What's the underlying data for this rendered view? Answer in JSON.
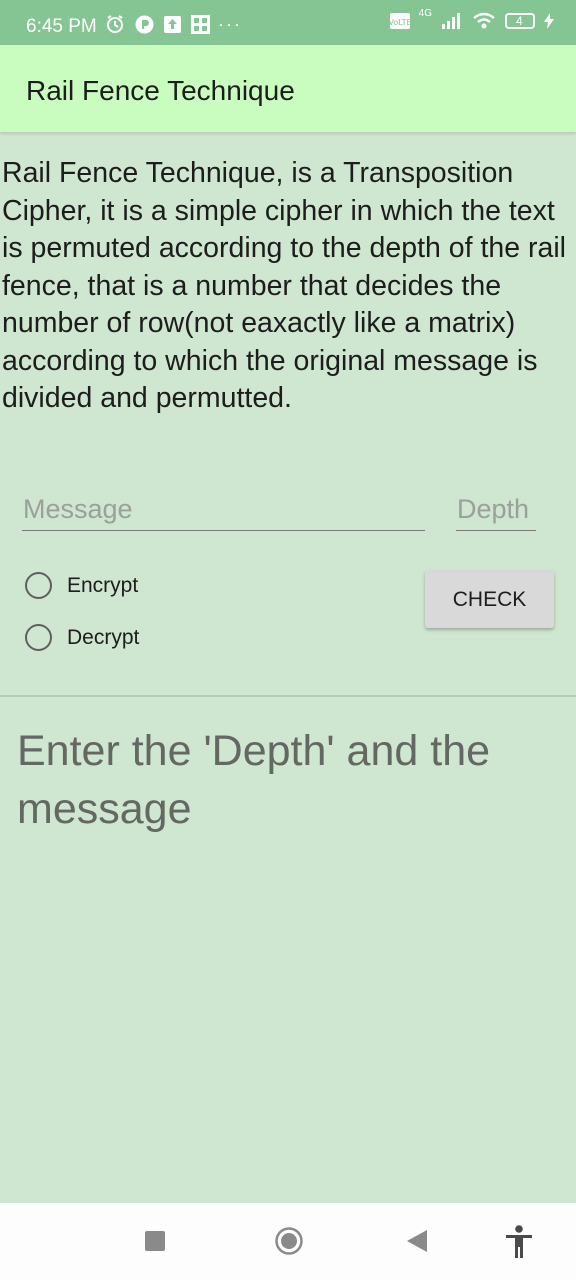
{
  "status": {
    "time": "6:45 PM",
    "more": "···",
    "network": "4G",
    "battery": "4"
  },
  "appbar": {
    "title": "Rail Fence Technique"
  },
  "description": "Rail Fence Technique, is a Transposition Cipher, it is a simple cipher in which the text is permuted according to the depth of the rail fence, that is a number that decides the number of row(not eaxactly like a matrix) according to which the original message is divided and permutted.",
  "form": {
    "message_placeholder": "Message",
    "message_value": "",
    "depth_placeholder": "Depth",
    "depth_value": "",
    "encrypt_label": "Encrypt",
    "decrypt_label": "Decrypt",
    "check_label": "CHECK"
  },
  "result_text": "Enter the 'Depth' and the message",
  "colors": {
    "status_bar": "#85c593",
    "app_bar": "#c9fdc0",
    "background": "#cfe6d0"
  },
  "navbar": {
    "icons": [
      "recents-icon",
      "home-icon",
      "back-icon",
      "accessibility-icon"
    ]
  }
}
